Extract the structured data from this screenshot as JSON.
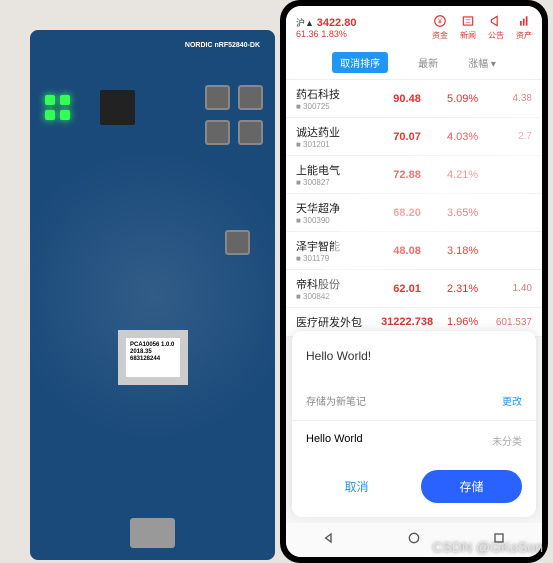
{
  "board": {
    "chip_label": "PCA10056\n1.0.0\n2018.35\n683128244",
    "brand": "NORDIC",
    "model": "nRF52840-DK"
  },
  "index": {
    "name": "沪▲",
    "value": "3422.80",
    "change": "61.36",
    "pct": "1.83%"
  },
  "top_icons": [
    {
      "label": "资金"
    },
    {
      "label": "新闻"
    },
    {
      "label": "公告"
    },
    {
      "label": "资产"
    }
  ],
  "tabs": {
    "sort": "取消排序",
    "latest": "最新",
    "change": "涨幅 ▾"
  },
  "stocks": [
    {
      "name": "药石科技",
      "code": "■ 300725",
      "price": "90.48",
      "pct": "5.09%",
      "ext": "4.38"
    },
    {
      "name": "诚达药业",
      "code": "■ 301201",
      "price": "70.07",
      "pct": "4.03%",
      "ext": "2.7"
    },
    {
      "name": "上能电气",
      "code": "■ 300827",
      "price": "72.88",
      "pct": "4.21%",
      "ext": ""
    },
    {
      "name": "天华超净",
      "code": "■ 300390",
      "price": "68.20",
      "pct": "3.65%",
      "ext": ""
    },
    {
      "name": "泽宇智能",
      "code": "■ 301179",
      "price": "48.08",
      "pct": "3.18%",
      "ext": ""
    },
    {
      "name": "帝科股份",
      "code": "■ 300842",
      "price": "62.01",
      "pct": "2.31%",
      "ext": "1.40"
    },
    {
      "name": "医疗研发外包",
      "code": "",
      "price": "31222.738",
      "pct": "1.96%",
      "ext": "601.537"
    }
  ],
  "popup": {
    "title": "Hello World!",
    "save_as": "存储为新笔记",
    "change": "更改",
    "note_name": "Hello World",
    "category": "未分类",
    "cancel": "取消",
    "save": "存储"
  },
  "watermark": "CSDN @GKoSon"
}
